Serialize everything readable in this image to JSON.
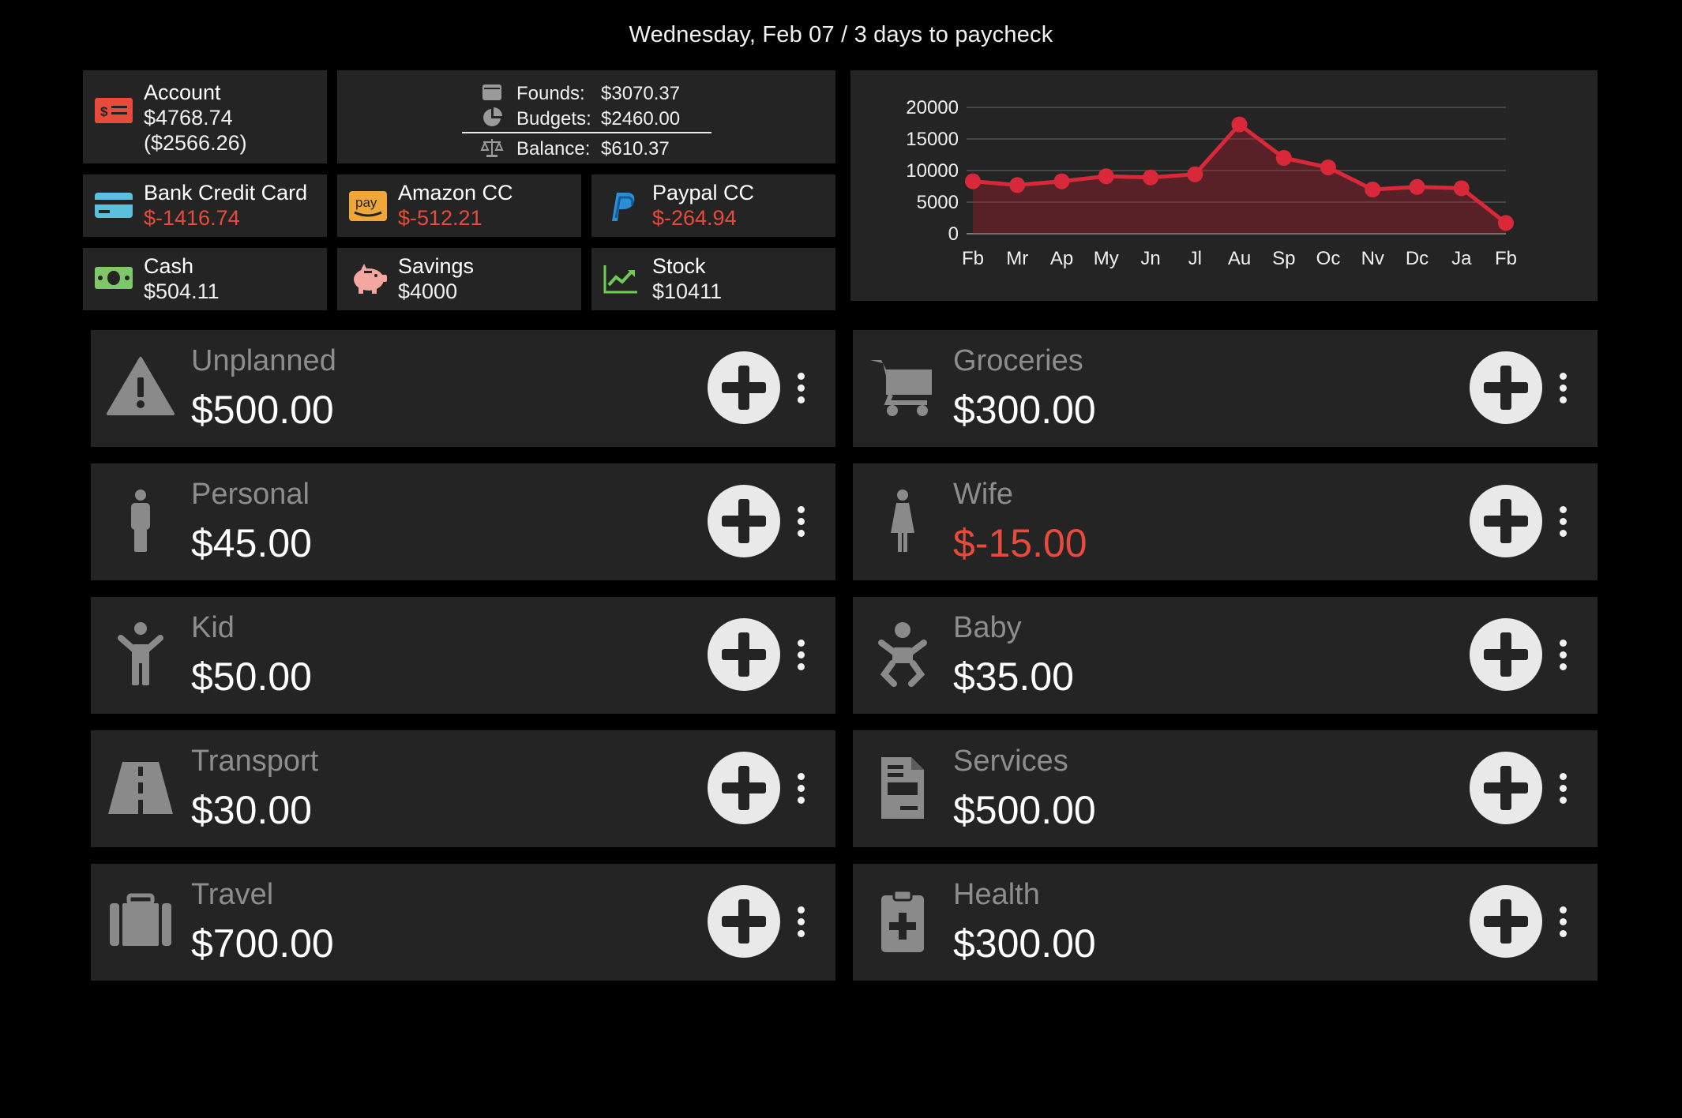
{
  "header": {
    "date_text": "Wednesday, Feb 07 / 3 days to paycheck"
  },
  "colors": {
    "background": "#000000",
    "tile": "#242424",
    "negative": "#e84b3c",
    "chart_line": "#d9283a",
    "category_label": "#8d8d8d"
  },
  "account": {
    "label": "Account",
    "balance": "$4768.74",
    "pending": "($2566.26)",
    "icon": "bill-icon"
  },
  "summary": {
    "founds_label": "Founds:",
    "founds_value": "$3070.37",
    "budgets_label": "Budgets:",
    "budgets_value": "$2460.00",
    "balance_label": "Balance:",
    "balance_value": "$610.37"
  },
  "accounts": [
    {
      "label": "Bank Credit Card",
      "value": "$-1416.74",
      "negative": true,
      "icon": "credit-card-icon"
    },
    {
      "label": "Amazon CC",
      "value": "$-512.21",
      "negative": true,
      "icon": "amazon-pay-icon"
    },
    {
      "label": "Paypal CC",
      "value": "$-264.94",
      "negative": true,
      "icon": "paypal-icon"
    },
    {
      "label": "Cash",
      "value": "$504.11",
      "negative": false,
      "icon": "cash-icon"
    },
    {
      "label": "Savings",
      "value": "$4000",
      "negative": false,
      "icon": "piggy-bank-icon"
    },
    {
      "label": "Stock",
      "value": "$10411",
      "negative": false,
      "icon": "stock-chart-icon"
    }
  ],
  "chart_data": {
    "type": "area",
    "categories": [
      "Fb",
      "Mr",
      "Ap",
      "My",
      "Jn",
      "Jl",
      "Au",
      "Sp",
      "Oc",
      "Nv",
      "Dc",
      "Ja",
      "Fb"
    ],
    "values": [
      8300,
      7700,
      8300,
      9100,
      8900,
      9400,
      17300,
      12000,
      10500,
      7000,
      7400,
      7200,
      1700
    ],
    "yticks": [
      "20000",
      "15000",
      "10000",
      "5000",
      "0"
    ],
    "ylim": [
      0,
      20000
    ],
    "grid": true,
    "title": "",
    "xlabel": "",
    "ylabel": ""
  },
  "categories": [
    {
      "name": "Unplanned",
      "amount": "$500.00",
      "negative": false,
      "icon": "warning-icon"
    },
    {
      "name": "Groceries",
      "amount": "$300.00",
      "negative": false,
      "icon": "cart-icon"
    },
    {
      "name": "Personal",
      "amount": "$45.00",
      "negative": false,
      "icon": "man-icon"
    },
    {
      "name": "Wife",
      "amount": "$-15.00",
      "negative": true,
      "icon": "woman-icon"
    },
    {
      "name": "Kid",
      "amount": "$50.00",
      "negative": false,
      "icon": "child-icon"
    },
    {
      "name": "Baby",
      "amount": "$35.00",
      "negative": false,
      "icon": "baby-icon"
    },
    {
      "name": "Transport",
      "amount": "$30.00",
      "negative": false,
      "icon": "road-icon"
    },
    {
      "name": "Services",
      "amount": "$500.00",
      "negative": false,
      "icon": "bill-document-icon"
    },
    {
      "name": "Travel",
      "amount": "$700.00",
      "negative": false,
      "icon": "suitcase-icon"
    },
    {
      "name": "Health",
      "amount": "$300.00",
      "negative": false,
      "icon": "medical-clipboard-icon"
    }
  ]
}
